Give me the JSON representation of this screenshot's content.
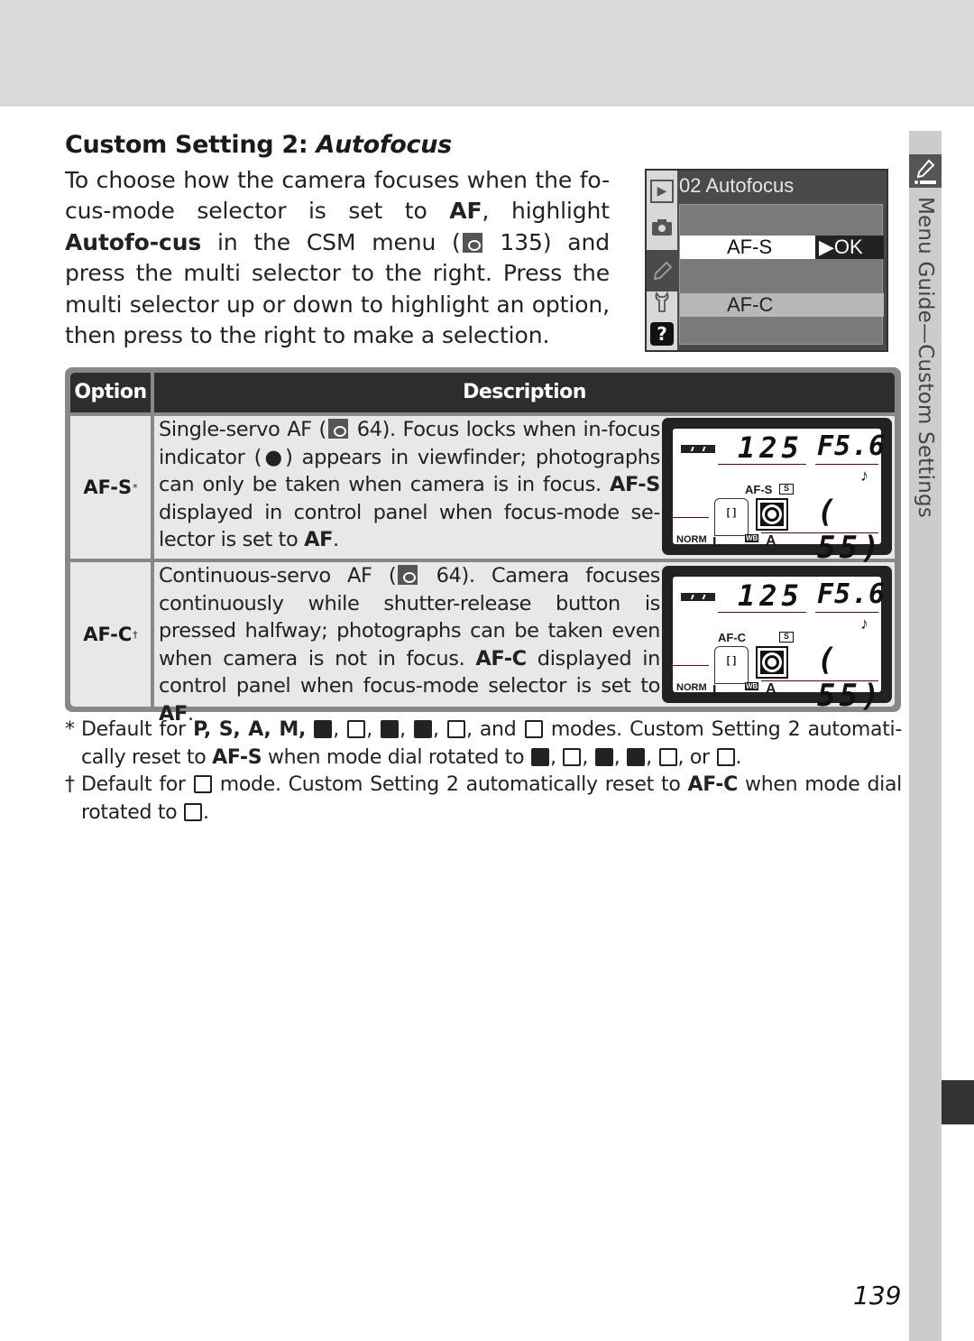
{
  "page": {
    "title_plain": "Custom Setting 2: ",
    "title_italic": "Autofocus",
    "page_number": "139",
    "side_tab_label": "Menu Guide—Custom Settings",
    "side_tab_icon": "pencil-icon"
  },
  "intro": {
    "t1": "To choose how the camera focuses when the fo-cus-mode selector is set to ",
    "b1": "AF",
    "t2": ", highlight ",
    "b2": "Autofo-cus",
    "t3": " in the CSM menu (",
    "ref_page": "135",
    "t4": ") and press the multi selector to the right.  Press the multi selector up or down to highlight an option, then press to the right to make a selection."
  },
  "camera_menu": {
    "title": "02 Autofocus",
    "tabs": [
      "playback-icon",
      "camera-icon",
      "pencil-icon",
      "wrench-icon",
      "help-icon"
    ],
    "help_glyph": "?",
    "play_glyph": "▶",
    "options": [
      {
        "label": "AF-S",
        "selected": true,
        "action": "▶OK"
      },
      {
        "label": "AF-C",
        "selected": false
      }
    ]
  },
  "table": {
    "headers": {
      "option": "Option",
      "description": "Description"
    },
    "rows": [
      {
        "option": "AF-S",
        "mark": "*",
        "d1": "Single-servo AF (",
        "ref_page": "64",
        "d2": ").  Focus locks when in-focus indicator (●) appears in viewfinder; photographs can only be taken when camera is in focus.  ",
        "b1": "AF-S",
        "d3": " displayed in control panel when focus-mode se-lector is set to ",
        "b2": "AF",
        "d4": ".",
        "panel": {
          "shutter": "125",
          "aperture": "F5.6",
          "af_mode": "AF-S",
          "release_mode": "S",
          "count": "55",
          "quality": "NORM",
          "size": "L",
          "wb_label": "WB",
          "wb": "A",
          "area": "[ ]",
          "beep": "♪",
          "bracket": "("
        }
      },
      {
        "option": "AF-C",
        "mark": "†",
        "d1": "Continuous-servo AF (",
        "ref_page": "64",
        "d2": ").   Camera focuses continuously while shutter-release button is pressed halfway; photographs can be taken even when camera is not in focus.  ",
        "b1": "AF-C",
        "d3": " displayed in control panel when focus-mode selector is set to ",
        "b2": "AF",
        "d4": ".",
        "panel": {
          "shutter": "125",
          "aperture": "F5.6",
          "af_mode": "AF-C",
          "release_mode": "S",
          "count": "55",
          "quality": "NORM",
          "size": "L",
          "wb_label": "WB",
          "wb": "A",
          "area": "[ ]",
          "beep": "♪",
          "bracket": "("
        }
      }
    ]
  },
  "footnotes": [
    {
      "mark": "*",
      "t1": "Default for ",
      "modes_bold": "P, S, A, M,",
      "t2": ", and ",
      "t3": " modes.  Custom Setting 2 automati-cally reset to ",
      "b1": "AF-S",
      "t4": " when mode dial rotated to ",
      "t5": ", or ",
      "t6": "."
    },
    {
      "mark": "†",
      "t1": "Default for ",
      "t2": " mode.  Custom Setting 2 automatically reset to ",
      "b1": "AF-C",
      "t3": " when mode dial rotated to ",
      "t4": "."
    }
  ],
  "mode_icons": [
    "auto-mode-icon",
    "portrait-mode-icon",
    "landscape-mode-icon",
    "close-up-mode-icon",
    "night-landscape-mode-icon",
    "night-portrait-mode-icon",
    "sports-mode-icon"
  ]
}
